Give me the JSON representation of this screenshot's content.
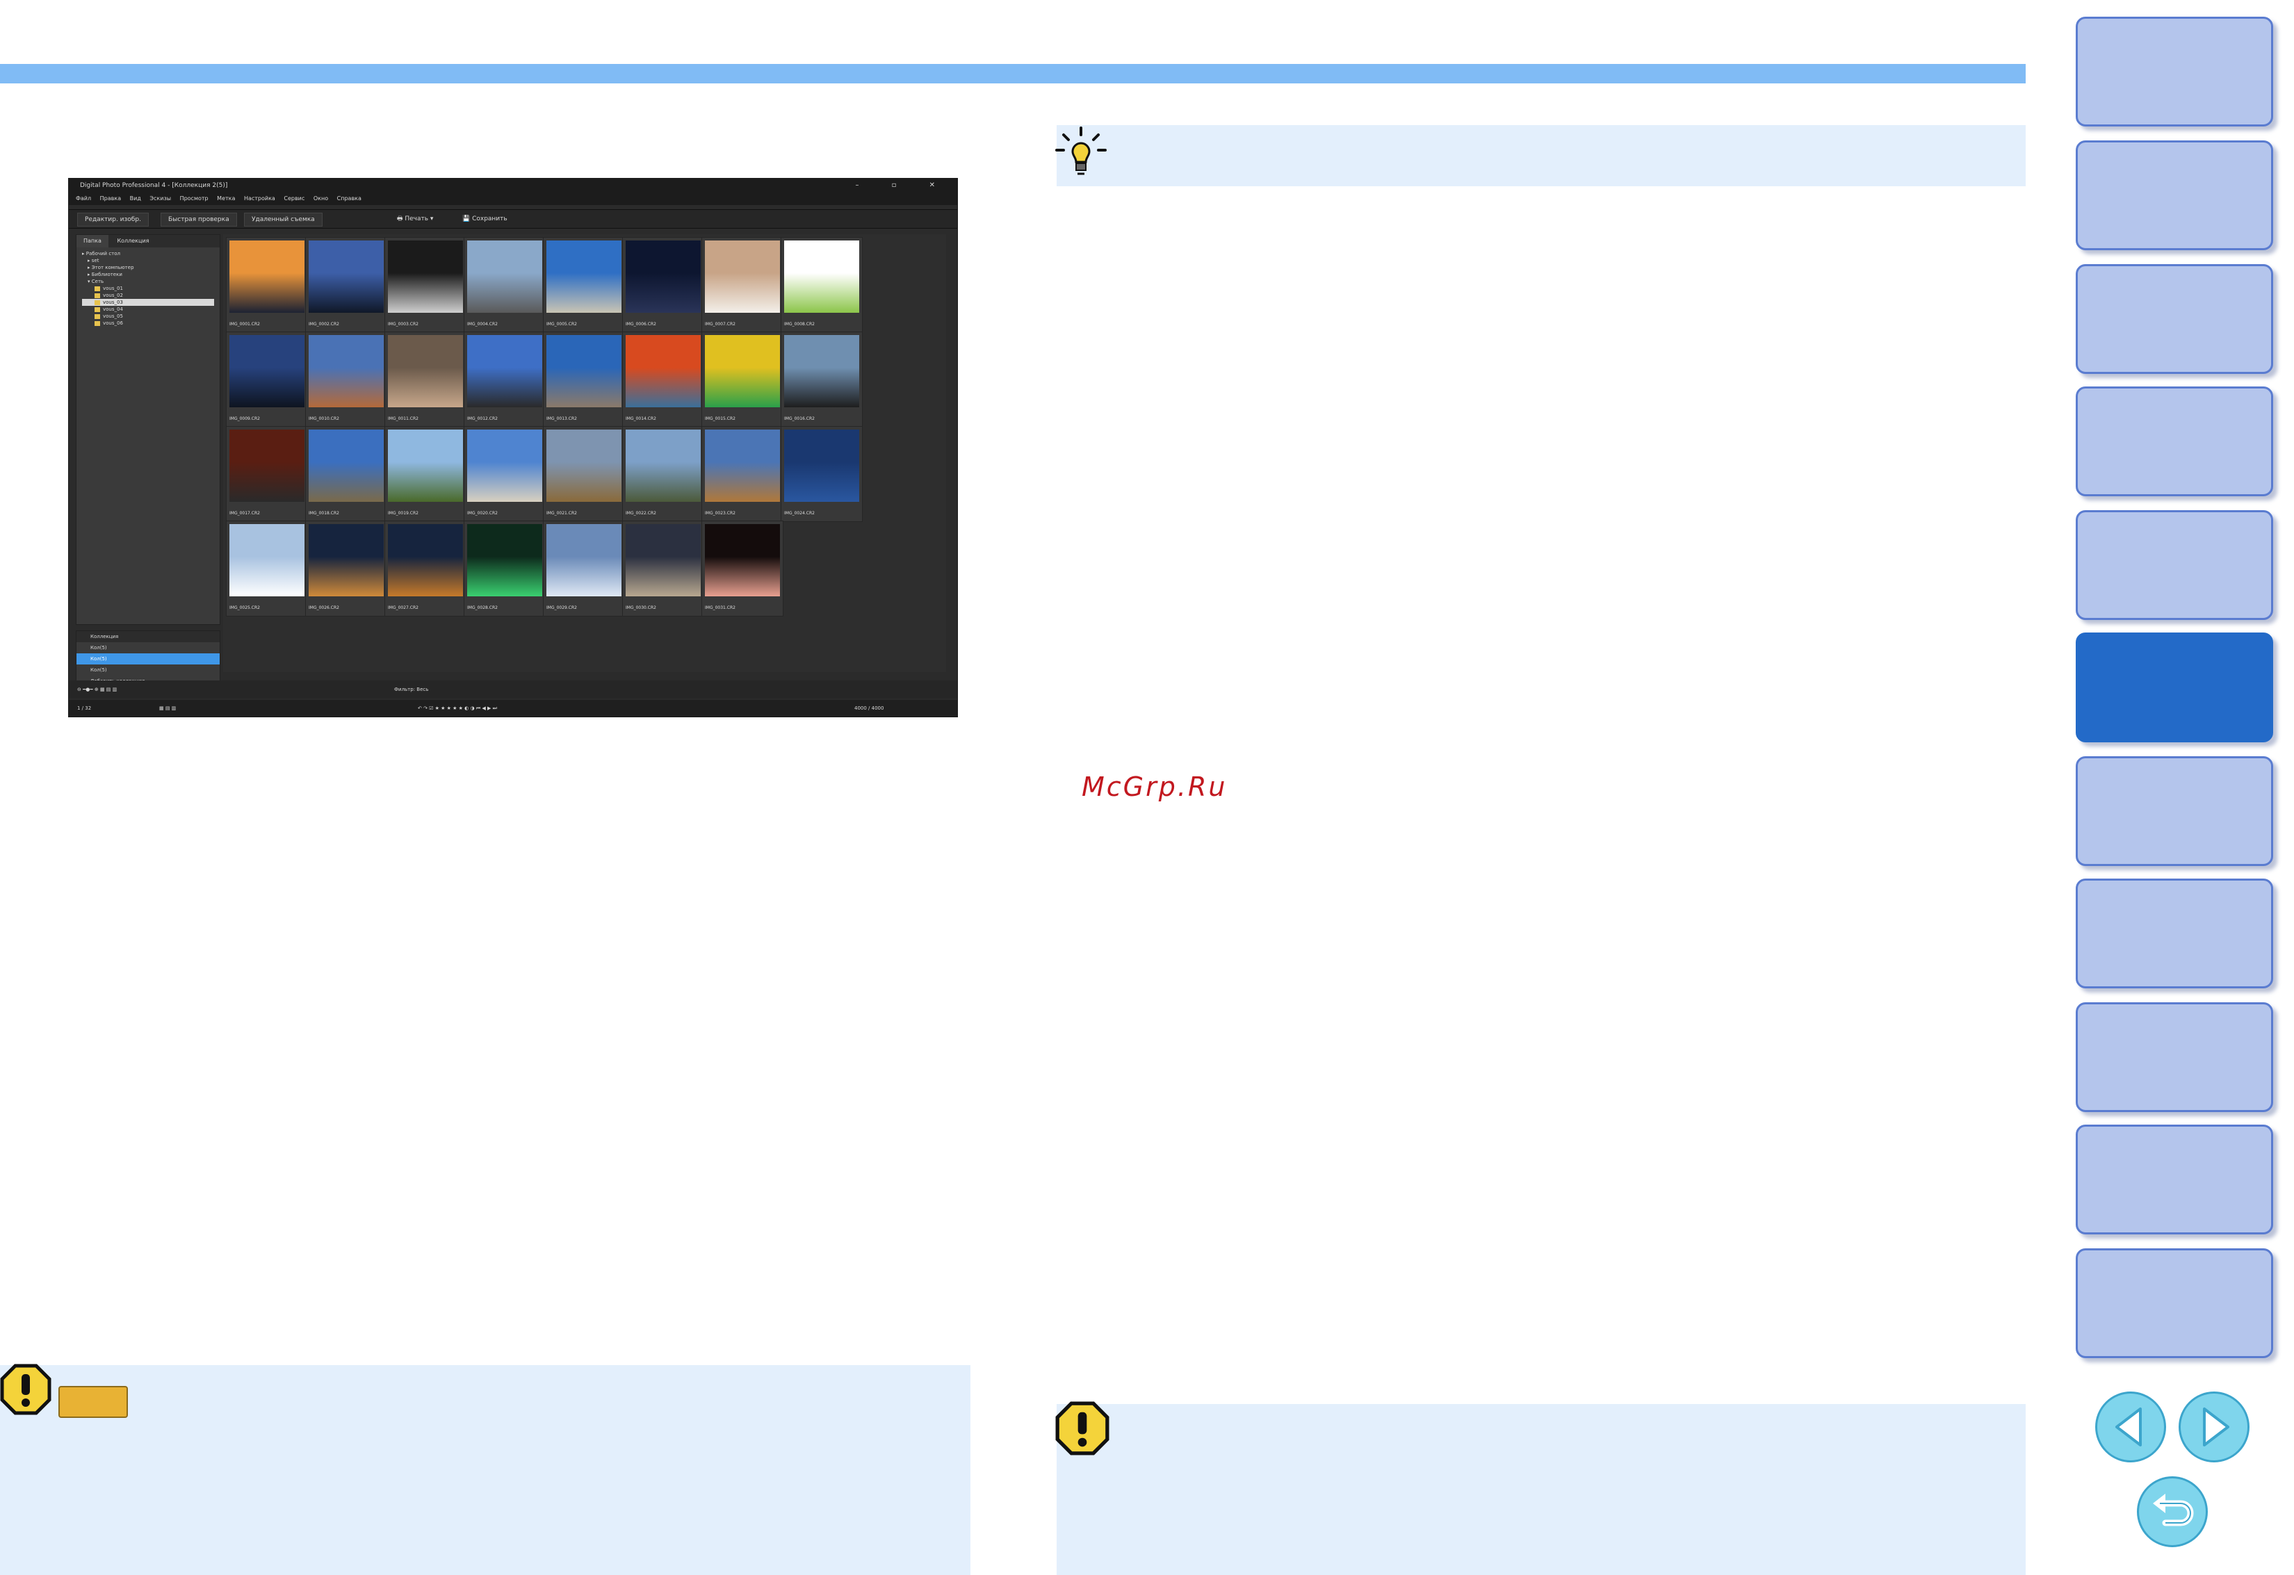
{
  "app": {
    "title": "Digital Photo Professional 4 - [Коллекция 2(5)]",
    "menu": [
      "Файл",
      "Правка",
      "Вид",
      "Эскизы",
      "Просмотр",
      "Метка",
      "Настройка",
      "Сервис",
      "Окно",
      "Справка"
    ],
    "toolbar_buttons": [
      "Редактир. изобр.",
      "Быстрая проверка",
      "Удаленный съемка"
    ],
    "print_label": "Печать",
    "save_label": "Сохранить",
    "left_tabs": [
      "Папка",
      "Коллекция"
    ],
    "tree": [
      "Рабочий стол",
      "set",
      "Этот компьютер",
      "Библиотеки",
      "Сеть",
      "vous_01",
      "vous_02",
      "vous_03",
      "vous_04",
      "vous_05",
      "vous_06"
    ],
    "collection_header": "Коллекция",
    "collections": [
      "Кол(5)",
      "Кол(5)",
      "Кол(5)"
    ],
    "add_collection": "Добавить коллекцию",
    "thumb_captions": [
      "IMG_0001.CR2",
      "IMG_0002.CR2",
      "IMG_0003.CR2",
      "IMG_0004.CR2",
      "IMG_0005.CR2",
      "IMG_0006.CR2",
      "IMG_0007.CR2",
      "IMG_0008.CR2",
      "IMG_0009.CR2",
      "IMG_0010.CR2",
      "IMG_0011.CR2",
      "IMG_0012.CR2",
      "IMG_0013.CR2",
      "IMG_0014.CR2",
      "IMG_0015.CR2",
      "IMG_0016.CR2",
      "IMG_0017.CR2",
      "IMG_0018.CR2",
      "IMG_0019.CR2",
      "IMG_0020.CR2",
      "IMG_0021.CR2",
      "IMG_0022.CR2",
      "IMG_0023.CR2",
      "IMG_0024.CR2",
      "IMG_0025.CR2",
      "IMG_0026.CR2",
      "IMG_0027.CR2",
      "IMG_0028.CR2",
      "IMG_0029.CR2",
      "IMG_0030.CR2",
      "IMG_0031.CR2"
    ],
    "status_left": "1 / 32",
    "status_right": "4000 / 4000",
    "filter_label": "Фильтр: Весь"
  },
  "watermark": "McGrp.Ru",
  "colors": {
    "top_bar": "#80bbf5",
    "note_box": "#e3effc",
    "nav_tab": "#b4c5ec",
    "nav_tab_active": "#236ac8",
    "nav_button": "#7fd5ec",
    "watermark": "#c2181f"
  },
  "icons": {
    "tip": "lightbulb-icon",
    "caution": "exclamation-icon",
    "prev": "arrow-left-icon",
    "next": "arrow-right-icon",
    "back": "return-icon"
  }
}
